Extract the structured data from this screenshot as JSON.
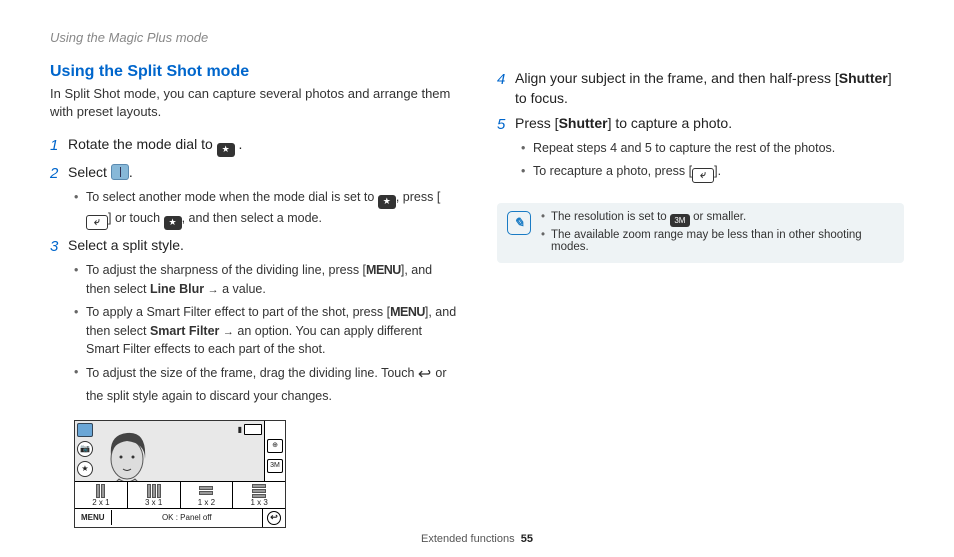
{
  "header": "Using the Magic Plus mode",
  "title": "Using the Split Shot mode",
  "intro": "In Split Shot mode, you can capture several photos and arrange them with preset layouts.",
  "steps": {
    "s1": "Rotate the mode dial to ",
    "s2": "Select ",
    "s2_sub_a": "To select another mode when the mode dial is set to ",
    "s2_sub_b": ", press [",
    "s2_sub_c": "] or touch ",
    "s2_sub_d": ", and then select a mode.",
    "s3": "Select a split style.",
    "s3_sub1_a": "To adjust the sharpness of the dividing line, press [",
    "s3_sub1_b": "], and then select ",
    "s3_lineblur": "Line Blur",
    "s3_sub1_c": " a value.",
    "s3_sub2_a": "To apply a Smart Filter effect to part of the shot, press [",
    "s3_sub2_b": "], and then select ",
    "s3_smartfilter": "Smart Filter",
    "s3_sub2_c": " an option. You can apply different Smart Filter effects to each part of the shot.",
    "s3_sub3_a": "To adjust the size of the frame, drag the dividing line. Touch ",
    "s3_sub3_b": " or the split style again to discard your changes.",
    "s4_a": "Align your subject in the frame, and then half-press [",
    "s4_shutter": "Shutter",
    "s4_b": "] to focus.",
    "s5_a": "Press [",
    "s5_shutter": "Shutter",
    "s5_b": "] to capture a photo.",
    "s5_sub1": "Repeat steps 4 and 5 to capture the rest of the photos.",
    "s5_sub2_a": "To recapture a photo, press [",
    "s5_sub2_b": "]."
  },
  "menu_word": "MENU",
  "notes": {
    "n1_a": "The resolution is set to ",
    "n1_b": " or smaller.",
    "n2": "The available zoom range may be less than in other shooting modes."
  },
  "lcd": {
    "panels": [
      "2 x 1",
      "3 x 1",
      "1 x 2",
      "1 x 3"
    ],
    "menu": "MENU",
    "ok_text": "OK : Panel off",
    "side_top": "⊕",
    "side_bot": "3M"
  },
  "footer_label": "Extended functions",
  "footer_page": "55",
  "chart_data": {
    "type": "table",
    "title": "Split style panel options",
    "categories": [
      "2 x 1",
      "3 x 1",
      "1 x 2",
      "1 x 3"
    ]
  }
}
